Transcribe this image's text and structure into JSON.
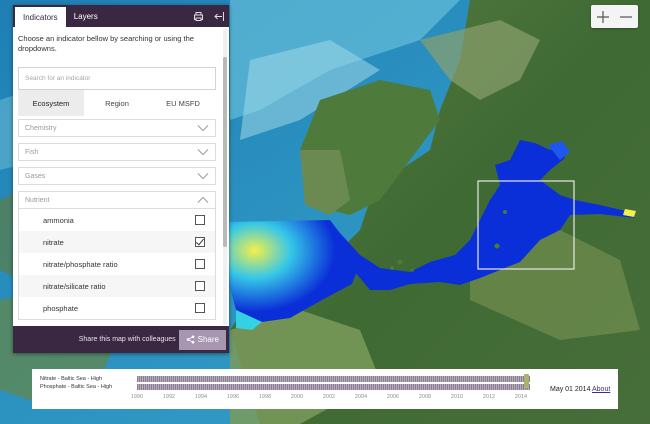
{
  "panel": {
    "tabs": [
      {
        "label": "Indicators",
        "active": true
      },
      {
        "label": "Layers",
        "active": false
      }
    ],
    "actions": [
      "print-icon",
      "collapse-panel-icon"
    ],
    "intro": "Choose an indicator bellow by searching or using the dropdowns.",
    "search": {
      "placeholder": "Search for an indicator",
      "value": ""
    },
    "subtabs": [
      {
        "label": "Ecosystem",
        "active": true
      },
      {
        "label": "Region",
        "active": false
      },
      {
        "label": "EU MSFD",
        "active": false
      }
    ],
    "categories": [
      {
        "label": "Chemistry",
        "open": false
      },
      {
        "label": "Fish",
        "open": false
      },
      {
        "label": "Gases",
        "open": false
      },
      {
        "label": "Nutrient",
        "open": true
      }
    ],
    "nutrient_items": [
      {
        "label": "ammonia",
        "checked": false
      },
      {
        "label": "nitrate",
        "checked": true
      },
      {
        "label": "nitrate/phosphate ratio",
        "checked": false
      },
      {
        "label": "nitrate/silicate ratio",
        "checked": false
      },
      {
        "label": "phosphate",
        "checked": false
      }
    ],
    "share": {
      "text": "Share this map with colleagues",
      "button": "Share"
    }
  },
  "zoom": {
    "in_icon": "plus-icon",
    "out_icon": "minus-icon"
  },
  "timeline": {
    "layers": [
      "Nitrate - Baltic Sea - High",
      "Phosphate - Baltic Sea - High"
    ],
    "years": [
      "1990",
      "1992",
      "1994",
      "1996",
      "1998",
      "2000",
      "2002",
      "2004",
      "2006",
      "2008",
      "2010",
      "2012",
      "2014"
    ],
    "current_date": "May 01 2014",
    "about": "About"
  },
  "colors": {
    "panel_dark": "#3a2742",
    "share_button": "#a796b0",
    "timeline_handle": "#a9b36a",
    "concentration_low": "#0a2fd8",
    "concentration_high": "#f4f04a"
  }
}
